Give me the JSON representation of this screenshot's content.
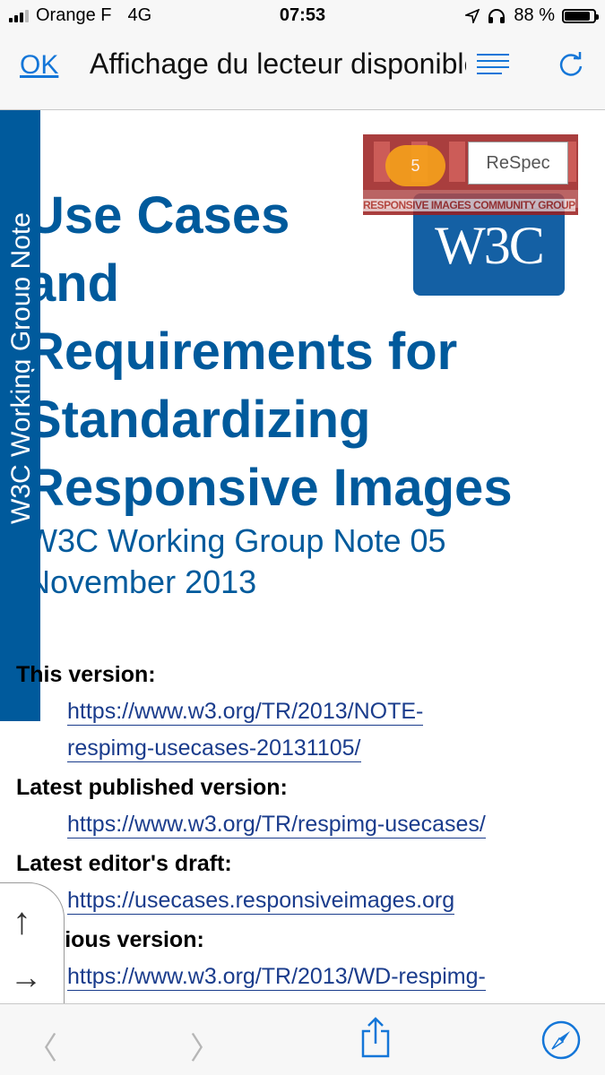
{
  "status_bar": {
    "carrier": "Orange F",
    "network": "4G",
    "time": "07:53",
    "battery": "88 %",
    "battery_level": 0.88
  },
  "nav_bar": {
    "done_label": "OK",
    "title": "Affichage du lecteur disponible"
  },
  "page": {
    "sidebar_label": "W3C Working Group Note",
    "logo_text": "W3C",
    "responsive_images_caption": "RESPONSIVE IMAGES COMMUNITY GROUP",
    "counter": "5",
    "respec_label": "ReSpec",
    "title_lines": [
      "Use Cases",
      "and",
      "Requirements for",
      "Standardizing",
      "Responsive Images"
    ],
    "subtitle_lines": [
      "W3C Working Group Note 05",
      "November 2013"
    ],
    "versions": [
      {
        "label": "This version:",
        "links": [
          "https://www.w3.org/TR/2013/NOTE-",
          "respimg-usecases-20131105/"
        ]
      },
      {
        "label": "Latest published version:",
        "links": [
          "https://www.w3.org/TR/respimg-usecases/"
        ]
      },
      {
        "label": "Latest editor's draft:",
        "links": [
          "https://usecases.responsiveimages.org"
        ]
      },
      {
        "label": "Previous version:",
        "links": [
          "https://www.w3.org/TR/2013/WD-respimg-"
        ]
      }
    ],
    "side_nav": {
      "up_icon": "arrow-up-icon",
      "next_icon": "arrow-right-icon"
    }
  },
  "toolbar": {
    "icons": [
      "chevron-left-icon",
      "chevron-right-icon",
      "share-icon",
      "compass-icon"
    ]
  },
  "colors": {
    "w3c_blue": "#005a9c",
    "ios_blue": "#1476d8",
    "link": "#1a3c8c"
  }
}
